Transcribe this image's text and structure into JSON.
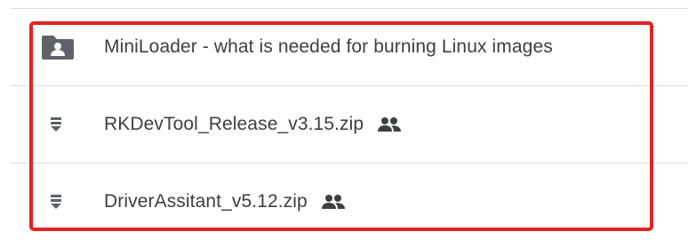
{
  "file_list": {
    "items": [
      {
        "type": "shared-folder",
        "icon": "shared-folder-icon",
        "name": "MiniLoader - what is needed for burning Linux images",
        "shared": false
      },
      {
        "type": "zip",
        "icon": "zip-file-icon",
        "name": "RKDevTool_Release_v3.15.zip",
        "shared": true,
        "shared_icon": "people-icon"
      },
      {
        "type": "zip",
        "icon": "zip-file-icon",
        "name": "DriverAssitant_v5.12.zip",
        "shared": true,
        "shared_icon": "people-icon"
      }
    ]
  },
  "colors": {
    "highlight": "#e02424",
    "icon": "#5f6368",
    "text": "#3c4043",
    "divider": "#dadce0"
  }
}
